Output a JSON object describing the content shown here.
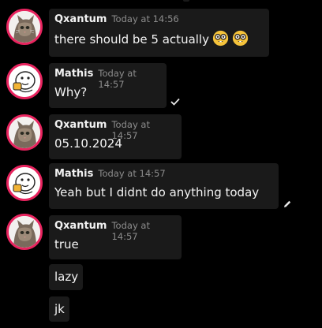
{
  "messages": [
    {
      "author": "Qxantum",
      "timestamp": "Today at 14:56",
      "text": "there should be 5 actually",
      "emojis": [
        "nerd-face-emoji",
        "nerd-face-emoji"
      ]
    },
    {
      "author": "Mathis",
      "timestamp": "Today at 14:57",
      "text": "Why?",
      "status_icon": "checkmark-icon"
    },
    {
      "author": "Qxantum",
      "timestamp": "Today at 14:57",
      "text": "05.10.2024"
    },
    {
      "author": "Mathis",
      "timestamp": "Today at 14:57",
      "text": "Yeah but I didnt do anything today",
      "status_icon": "pencil-icon"
    },
    {
      "author": "Qxantum",
      "timestamp": "Today at 14:57",
      "text": "true"
    }
  ],
  "followups": [
    "lazy",
    "jk"
  ],
  "colors": {
    "background": "#000000",
    "bubble": "#1a1a1a",
    "avatar_ring": "#e8245f",
    "timestamp": "#8d8d8d",
    "text": "#f4f4f4"
  },
  "avatars": {
    "qxantum": "cat-avatar",
    "mathis": "cartoon-face-avatar"
  }
}
